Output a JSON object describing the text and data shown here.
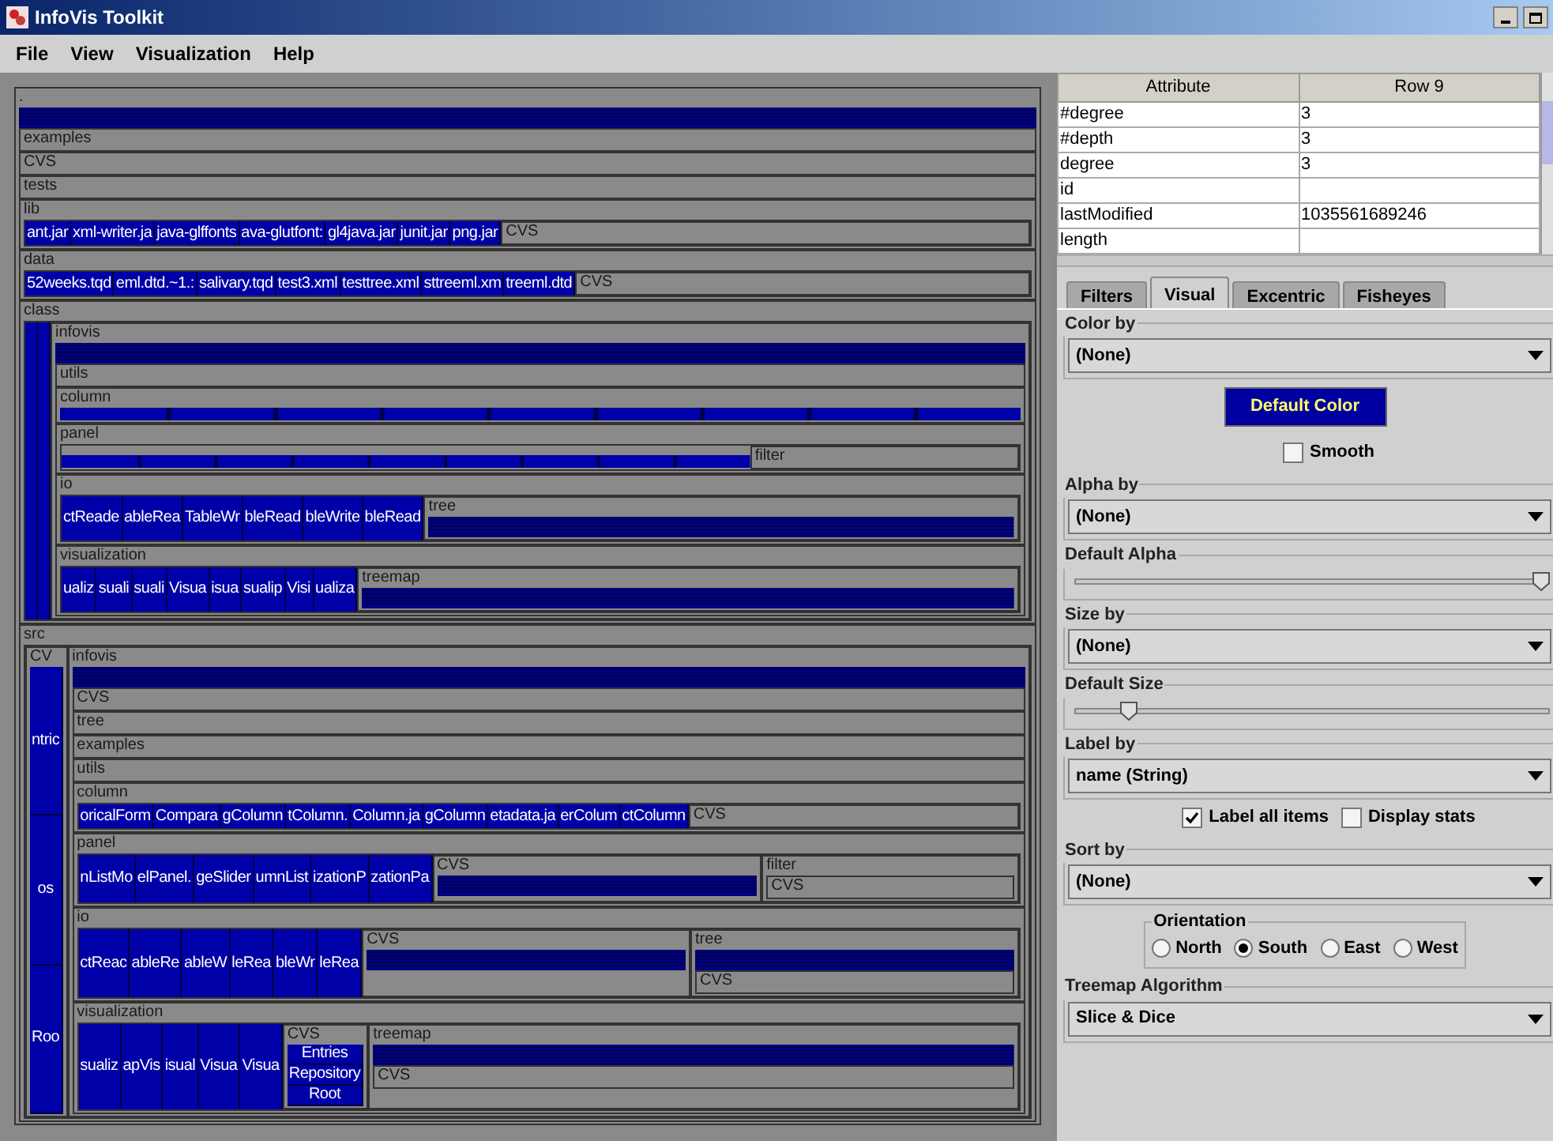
{
  "window": {
    "title": "InfoVis Toolkit"
  },
  "menu": [
    "File",
    "View",
    "Visualization",
    "Help"
  ],
  "treemap": {
    "kind": "group",
    "label": ".",
    "children": [
      {
        "kind": "stripes"
      },
      {
        "kind": "group",
        "label": "examples"
      },
      {
        "kind": "group",
        "label": "CVS"
      },
      {
        "kind": "group",
        "label": "tests"
      },
      {
        "kind": "row",
        "label": "lib",
        "children": [
          {
            "kind": "leaf",
            "label": "ant.jar"
          },
          {
            "kind": "leaf",
            "label": "xml-writer.ja"
          },
          {
            "kind": "leaf",
            "label": "java-glffonts"
          },
          {
            "kind": "leaf",
            "label": "ava-glutfont:"
          },
          {
            "kind": "leaf",
            "label": "gl4java.jar"
          },
          {
            "kind": "leaf",
            "label": "junit.jar"
          },
          {
            "kind": "leaf",
            "label": "png.jar"
          },
          {
            "kind": "group",
            "label": "CVS"
          }
        ]
      },
      {
        "kind": "row",
        "label": "data",
        "children": [
          {
            "kind": "leaf",
            "label": "52weeks.tqd"
          },
          {
            "kind": "leaf",
            "label": "eml.dtd.~1.:"
          },
          {
            "kind": "leaf",
            "label": "salivary.tqd"
          },
          {
            "kind": "leaf",
            "label": "test3.xml"
          },
          {
            "kind": "leaf",
            "label": "testtree.xml"
          },
          {
            "kind": "leaf",
            "label": "sttreeml.xm"
          },
          {
            "kind": "leaf",
            "label": "treeml.dtd"
          },
          {
            "kind": "group",
            "label": "CVS"
          }
        ]
      },
      {
        "kind": "row",
        "label": "class",
        "children": [
          {
            "kind": "strip"
          },
          {
            "kind": "strip"
          },
          {
            "kind": "group",
            "label": "infovis",
            "children": [
              {
                "kind": "stripes"
              },
              {
                "kind": "group",
                "label": "utils"
              },
              {
                "kind": "group",
                "label": "column",
                "children": [
                  {
                    "kind": "bar"
                  }
                ]
              },
              {
                "kind": "row",
                "label": "panel",
                "children": [
                  {
                    "kind": "bar"
                  },
                  {
                    "kind": "group",
                    "label": "filter"
                  }
                ]
              },
              {
                "kind": "row",
                "label": "io",
                "children": [
                  {
                    "kind": "leaf",
                    "label": "ctReade"
                  },
                  {
                    "kind": "leaf",
                    "label": "ableRea"
                  },
                  {
                    "kind": "leaf",
                    "label": "TableWr"
                  },
                  {
                    "kind": "leaf",
                    "label": "bleRead"
                  },
                  {
                    "kind": "leaf",
                    "label": "bleWrite"
                  },
                  {
                    "kind": "leaf",
                    "label": "bleRead"
                  },
                  {
                    "kind": "group",
                    "label": "tree",
                    "children": [
                      {
                        "kind": "stripes"
                      }
                    ]
                  }
                ]
              },
              {
                "kind": "row",
                "label": "visualization",
                "children": [
                  {
                    "kind": "leaf",
                    "label": "ualiz"
                  },
                  {
                    "kind": "leaf",
                    "label": "suali"
                  },
                  {
                    "kind": "leaf",
                    "label": "suali"
                  },
                  {
                    "kind": "leaf",
                    "label": "Visua"
                  },
                  {
                    "kind": "leaf",
                    "label": "isua"
                  },
                  {
                    "kind": "leaf",
                    "label": "sualip"
                  },
                  {
                    "kind": "leaf",
                    "label": "Visi"
                  },
                  {
                    "kind": "leaf",
                    "label": "ualiza"
                  },
                  {
                    "kind": "group",
                    "label": "treemap",
                    "children": [
                      {
                        "kind": "stripes"
                      }
                    ]
                  }
                ]
              }
            ]
          }
        ]
      },
      {
        "kind": "row",
        "label": "src",
        "children": [
          {
            "kind": "group",
            "label": "CV",
            "children": [
              {
                "kind": "leaf",
                "label": "ntric"
              },
              {
                "kind": "leaf",
                "label": "os"
              },
              {
                "kind": "leaf",
                "label": "Roo"
              }
            ]
          },
          {
            "kind": "group",
            "label": "infovis",
            "children": [
              {
                "kind": "stripes"
              },
              {
                "kind": "group",
                "label": "CVS"
              },
              {
                "kind": "group",
                "label": "tree"
              },
              {
                "kind": "group",
                "label": "examples"
              },
              {
                "kind": "group",
                "label": "utils"
              },
              {
                "kind": "row",
                "label": "column",
                "children": [
                  {
                    "kind": "leaf",
                    "label": "oricalForm"
                  },
                  {
                    "kind": "leaf",
                    "label": "Compara"
                  },
                  {
                    "kind": "leaf",
                    "label": "gColumn"
                  },
                  {
                    "kind": "leaf",
                    "label": "tColumn."
                  },
                  {
                    "kind": "leaf",
                    "label": "Column.ja"
                  },
                  {
                    "kind": "leaf",
                    "label": "gColumn"
                  },
                  {
                    "kind": "leaf",
                    "label": "etadata.ja"
                  },
                  {
                    "kind": "leaf",
                    "label": "erColum"
                  },
                  {
                    "kind": "leaf",
                    "label": "ctColumn"
                  },
                  {
                    "kind": "group",
                    "label": "CVS"
                  }
                ]
              },
              {
                "kind": "row",
                "label": "panel",
                "children": [
                  {
                    "kind": "leaf",
                    "label": "nListMo"
                  },
                  {
                    "kind": "leaf",
                    "label": "elPanel."
                  },
                  {
                    "kind": "leaf",
                    "label": "geSlider"
                  },
                  {
                    "kind": "leaf",
                    "label": "umnList"
                  },
                  {
                    "kind": "leaf",
                    "label": "izationP"
                  },
                  {
                    "kind": "leaf",
                    "label": "zationPa"
                  },
                  {
                    "kind": "group",
                    "label": "CVS",
                    "children": [
                      {
                        "kind": "stripes"
                      }
                    ]
                  },
                  {
                    "kind": "group",
                    "label": "filter",
                    "children": [
                      {
                        "kind": "group",
                        "label": "CVS"
                      }
                    ]
                  }
                ]
              },
              {
                "kind": "row",
                "label": "io",
                "children": [
                  {
                    "kind": "leaf",
                    "label": "ctReac"
                  },
                  {
                    "kind": "leaf",
                    "label": "ableRe"
                  },
                  {
                    "kind": "leaf",
                    "label": "ableW"
                  },
                  {
                    "kind": "leaf",
                    "label": "leRea"
                  },
                  {
                    "kind": "leaf",
                    "label": "bleWr"
                  },
                  {
                    "kind": "leaf",
                    "label": "leRea"
                  },
                  {
                    "kind": "group",
                    "label": "CVS",
                    "children": [
                      {
                        "kind": "stripes"
                      }
                    ]
                  },
                  {
                    "kind": "group",
                    "label": "tree",
                    "children": [
                      {
                        "kind": "stripes"
                      },
                      {
                        "kind": "group",
                        "label": "CVS"
                      }
                    ]
                  }
                ]
              },
              {
                "kind": "row",
                "label": "visualization",
                "children": [
                  {
                    "kind": "leaf",
                    "label": "sualiz"
                  },
                  {
                    "kind": "leaf",
                    "label": "apVis"
                  },
                  {
                    "kind": "leaf",
                    "label": "isual"
                  },
                  {
                    "kind": "leaf",
                    "label": "Visua"
                  },
                  {
                    "kind": "leaf",
                    "label": "Visua"
                  },
                  {
                    "kind": "group",
                    "label": "CVS",
                    "children": [
                      {
                        "kind": "leaf",
                        "label": "Entries"
                      },
                      {
                        "kind": "leaf",
                        "label": "Repository"
                      },
                      {
                        "kind": "leaf",
                        "label": "Root"
                      }
                    ]
                  },
                  {
                    "kind": "group",
                    "label": "treemap",
                    "children": [
                      {
                        "kind": "stripes"
                      },
                      {
                        "kind": "group",
                        "label": "CVS"
                      }
                    ]
                  }
                ]
              }
            ]
          }
        ]
      }
    ]
  },
  "table": {
    "columns": [
      "Attribute",
      "Row 9"
    ],
    "rows": [
      {
        "attribute": "#degree",
        "value": "3"
      },
      {
        "attribute": "#depth",
        "value": "3"
      },
      {
        "attribute": "degree",
        "value": "3"
      },
      {
        "attribute": "id"
      },
      {
        "attribute": "lastModified",
        "value": "1035561689246"
      },
      {
        "attribute": "length"
      }
    ]
  },
  "tabs": [
    {
      "label": "Filters",
      "selected": false
    },
    {
      "label": "Visual",
      "selected": true
    },
    {
      "label": "Excentric",
      "selected": false
    },
    {
      "label": "Fisheyes",
      "selected": false
    }
  ],
  "controls": [
    {
      "kind": "select",
      "title": "Color by",
      "value": "(None)"
    },
    {
      "kind": "button",
      "label": "Default Color"
    },
    {
      "kind": "checks",
      "items": [
        {
          "label": "Smooth",
          "checked": false
        }
      ]
    },
    {
      "kind": "select",
      "title": "Alpha by",
      "value": "(None)"
    },
    {
      "kind": "slider",
      "title": "Default Alpha",
      "level": 1
    },
    {
      "kind": "select",
      "title": "Size by",
      "value": "(None)"
    },
    {
      "kind": "slider",
      "title": "Default Size",
      "level": 0.1
    },
    {
      "kind": "select",
      "title": "Label by",
      "value": "name (String)"
    },
    {
      "kind": "checks",
      "items": [
        {
          "label": "Label all items",
          "checked": true
        },
        {
          "label": "Display stats",
          "checked": false
        }
      ]
    },
    {
      "kind": "select",
      "title": "Sort by",
      "value": "(None)"
    },
    {
      "kind": "radio",
      "title": "Orientation",
      "options": [
        {
          "label": "North",
          "selected": false
        },
        {
          "label": "South",
          "selected": true
        },
        {
          "label": "East",
          "selected": false
        },
        {
          "label": "West",
          "selected": false
        }
      ]
    },
    {
      "kind": "select",
      "title": "Treemap Algorithm",
      "value": "Slice & Dice"
    }
  ]
}
